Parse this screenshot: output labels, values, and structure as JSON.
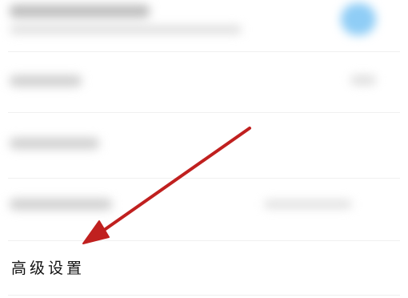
{
  "settings": {
    "advanced_label": "高级设置"
  },
  "annotation": {
    "arrow_color": "#c0201f"
  },
  "colors": {
    "toggle_on": "#8fcdf6",
    "background": "#ffffff"
  }
}
